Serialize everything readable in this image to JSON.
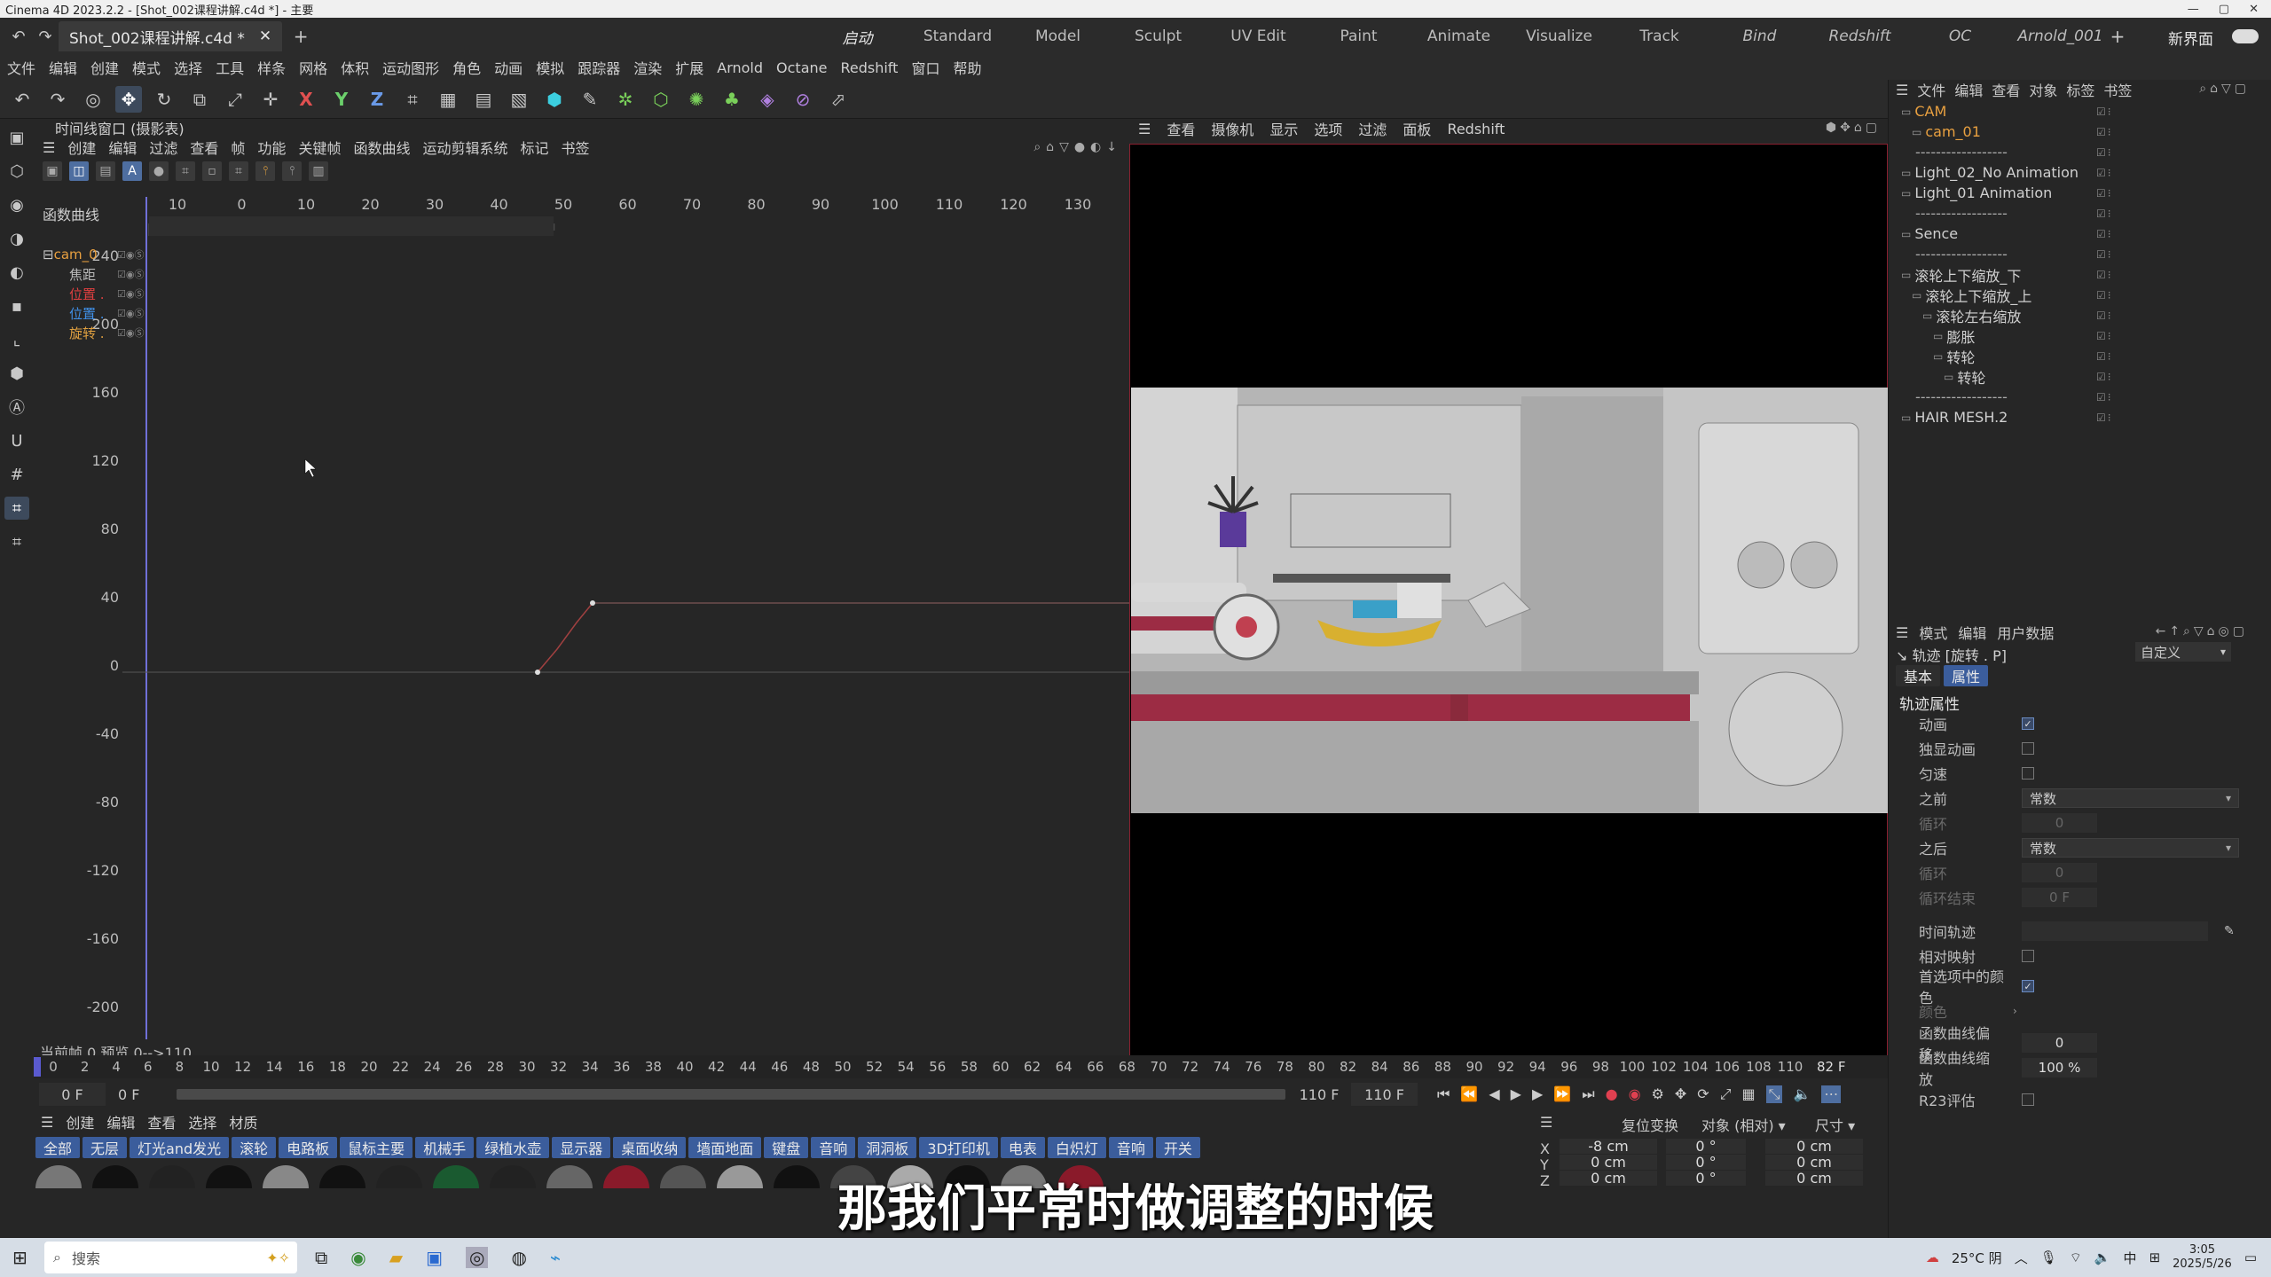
{
  "window_title": "Cinema 4D 2023.2.2 - [Shot_002课程讲解.c4d *] - 主要",
  "doc_tab": "Shot_002课程讲解.c4d *",
  "layouts": [
    {
      "label": "启动",
      "style": "act"
    },
    {
      "label": "Standard",
      "style": ""
    },
    {
      "label": "Model",
      "style": ""
    },
    {
      "label": "Sculpt",
      "style": ""
    },
    {
      "label": "UV Edit",
      "style": ""
    },
    {
      "label": "Paint",
      "style": ""
    },
    {
      "label": "Animate",
      "style": ""
    },
    {
      "label": "Visualize",
      "style": ""
    },
    {
      "label": "Track",
      "style": ""
    },
    {
      "label": "Bind",
      "style": "it"
    },
    {
      "label": "Redshift",
      "style": "it"
    },
    {
      "label": "OC",
      "style": "it"
    },
    {
      "label": "Arnold_001",
      "style": "it"
    }
  ],
  "new_layout": "新界面",
  "menu": [
    "文件",
    "编辑",
    "创建",
    "模式",
    "选择",
    "工具",
    "样条",
    "网格",
    "体积",
    "运动图形",
    "角色",
    "动画",
    "模拟",
    "跟踪器",
    "渲染",
    "扩展",
    "Arnold",
    "Octane",
    "Redshift",
    "窗口",
    "帮助"
  ],
  "timeline": {
    "title": "时间线窗口 (摄影表)",
    "menu": [
      "创建",
      "编辑",
      "过滤",
      "查看",
      "帧",
      "功能",
      "关键帧",
      "函数曲线",
      "运动剪辑系统",
      "标记",
      "书签"
    ],
    "section": "函数曲线",
    "tracks": [
      {
        "label": "cam_0",
        "color": "#e8a040"
      },
      {
        "label": "焦距",
        "color": "#bbbbbb"
      },
      {
        "label": "位置 .",
        "color": "#e04040"
      },
      {
        "label": "位置 .",
        "color": "#4090e8"
      },
      {
        "label": "旋转 .",
        "color": "#e0a040"
      }
    ],
    "top_ticks": [
      "10",
      "0",
      "10",
      "20",
      "30",
      "40",
      "50",
      "60",
      "70",
      "80",
      "90",
      "100",
      "110",
      "120",
      "130"
    ],
    "y_ticks": [
      "240",
      "200",
      "160",
      "120",
      "80",
      "40",
      "0",
      "-40",
      "-80",
      "-120",
      "-160",
      "-200"
    ],
    "status": "当前帧  0  预览  0-->110"
  },
  "viewport": {
    "menu": [
      "查看",
      "摄像机",
      "显示",
      "选项",
      "过滤",
      "面板",
      "Redshift"
    ]
  },
  "objects": [
    {
      "name": "CAM",
      "color": "#e8a040",
      "indent": 0
    },
    {
      "name": "cam_01",
      "color": "#e8a040",
      "indent": 1
    },
    {
      "name": "------------------",
      "color": "#aaaaaa",
      "indent": 1
    },
    {
      "name": "Light_02_No Animation",
      "color": "#d0d0d0",
      "indent": 0
    },
    {
      "name": "Light_01 Animation",
      "color": "#d0d0d0",
      "indent": 0
    },
    {
      "name": "------------------",
      "color": "#aaaaaa",
      "indent": 1
    },
    {
      "name": "Sence",
      "color": "#d0d0d0",
      "indent": 0
    },
    {
      "name": "------------------",
      "color": "#aaaaaa",
      "indent": 1
    },
    {
      "name": "滚轮上下缩放_下",
      "color": "#d0d0d0",
      "indent": 0
    },
    {
      "name": "滚轮上下缩放_上",
      "color": "#d0d0d0",
      "indent": 1
    },
    {
      "name": "滚轮左右缩放",
      "color": "#d0d0d0",
      "indent": 2
    },
    {
      "name": "膨胀",
      "color": "#d0d0d0",
      "indent": 3
    },
    {
      "name": "转轮",
      "color": "#d0d0d0",
      "indent": 3
    },
    {
      "name": "转轮",
      "color": "#d0d0d0",
      "indent": 4
    },
    {
      "name": "------------------",
      "color": "#aaaaaa",
      "indent": 1
    },
    {
      "name": "HAIR MESH.2",
      "color": "#d0d0d0",
      "indent": 0
    }
  ],
  "obj_menu": [
    "文件",
    "编辑",
    "查看",
    "对象",
    "标签",
    "书签"
  ],
  "attr": {
    "menu": [
      "模式",
      "编辑",
      "用户数据"
    ],
    "track_label": "轨迹 [旋转 . P]",
    "preset": "自定义",
    "tabs": [
      "基本",
      "属性"
    ],
    "section": "轨迹属性",
    "animation": "动画",
    "solo": "独显动画",
    "constant_speed": "匀速",
    "before": "之前",
    "before_val": "常数",
    "loop": "循环",
    "loop_val": "0",
    "after": "之后",
    "after_val": "常数",
    "loop2": "循环",
    "loop2_val": "0",
    "loop_end": "循环结束",
    "loop_end_val": "0 F",
    "time_track": "时间轨迹",
    "relative": "相对映射",
    "sel_color": "首选项中的颜色",
    "color": "颜色",
    "curve_offset": "函数曲线偏移",
    "curve_offset_val": "0",
    "curve_scale": "函数曲线缩放",
    "curve_scale_val": "100 %",
    "r23": "R23评估"
  },
  "ruler_labels": [
    "0",
    "2",
    "4",
    "6",
    "8",
    "10",
    "12",
    "14",
    "16",
    "18",
    "20",
    "22",
    "24",
    "26",
    "28",
    "30",
    "32",
    "34",
    "36",
    "38",
    "40",
    "42",
    "44",
    "46",
    "48",
    "50",
    "52",
    "54",
    "56",
    "58",
    "60",
    "62",
    "64",
    "66",
    "68",
    "70",
    "72",
    "74",
    "76",
    "78",
    "80",
    "82",
    "84",
    "86",
    "88",
    "90",
    "92",
    "94",
    "96",
    "98",
    "100",
    "102",
    "104",
    "106",
    "108",
    "110"
  ],
  "ruler_end": "82 F",
  "transport": {
    "start": "0 F",
    "cur": "0 F",
    "end": "110 F",
    "end2": "110 F"
  },
  "mat": {
    "menu": [
      "创建",
      "编辑",
      "查看",
      "选择",
      "材质"
    ],
    "chips": [
      "全部",
      "无层",
      "灯光and发光",
      "滚轮",
      "电路板",
      "鼠标主要",
      "机械手",
      "绿植水壶",
      "显示器",
      "桌面收纳",
      "墙面地面",
      "键盘",
      "音响",
      "洞洞板",
      "3D打印机",
      "电表",
      "白炽灯",
      "音响",
      "开关"
    ]
  },
  "coords": {
    "mode1": "复位变换",
    "mode2": "对象 (相对)",
    "mode3": "尺寸",
    "rows": [
      {
        "axis": "X",
        "pos": "-8 cm",
        "rot": "0 °",
        "size": "0 cm"
      },
      {
        "axis": "Y",
        "pos": "0 cm",
        "rot": "0 °",
        "size": "0 cm"
      },
      {
        "axis": "Z",
        "pos": "0 cm",
        "rot": "0 °",
        "size": "0 cm"
      }
    ]
  },
  "subtitle": "那我们平常时做调整的时候",
  "taskbar": {
    "search": "搜索",
    "weather": "25°C 阴",
    "ime": "中",
    "time": "3:05",
    "date": "2025/5/26"
  }
}
